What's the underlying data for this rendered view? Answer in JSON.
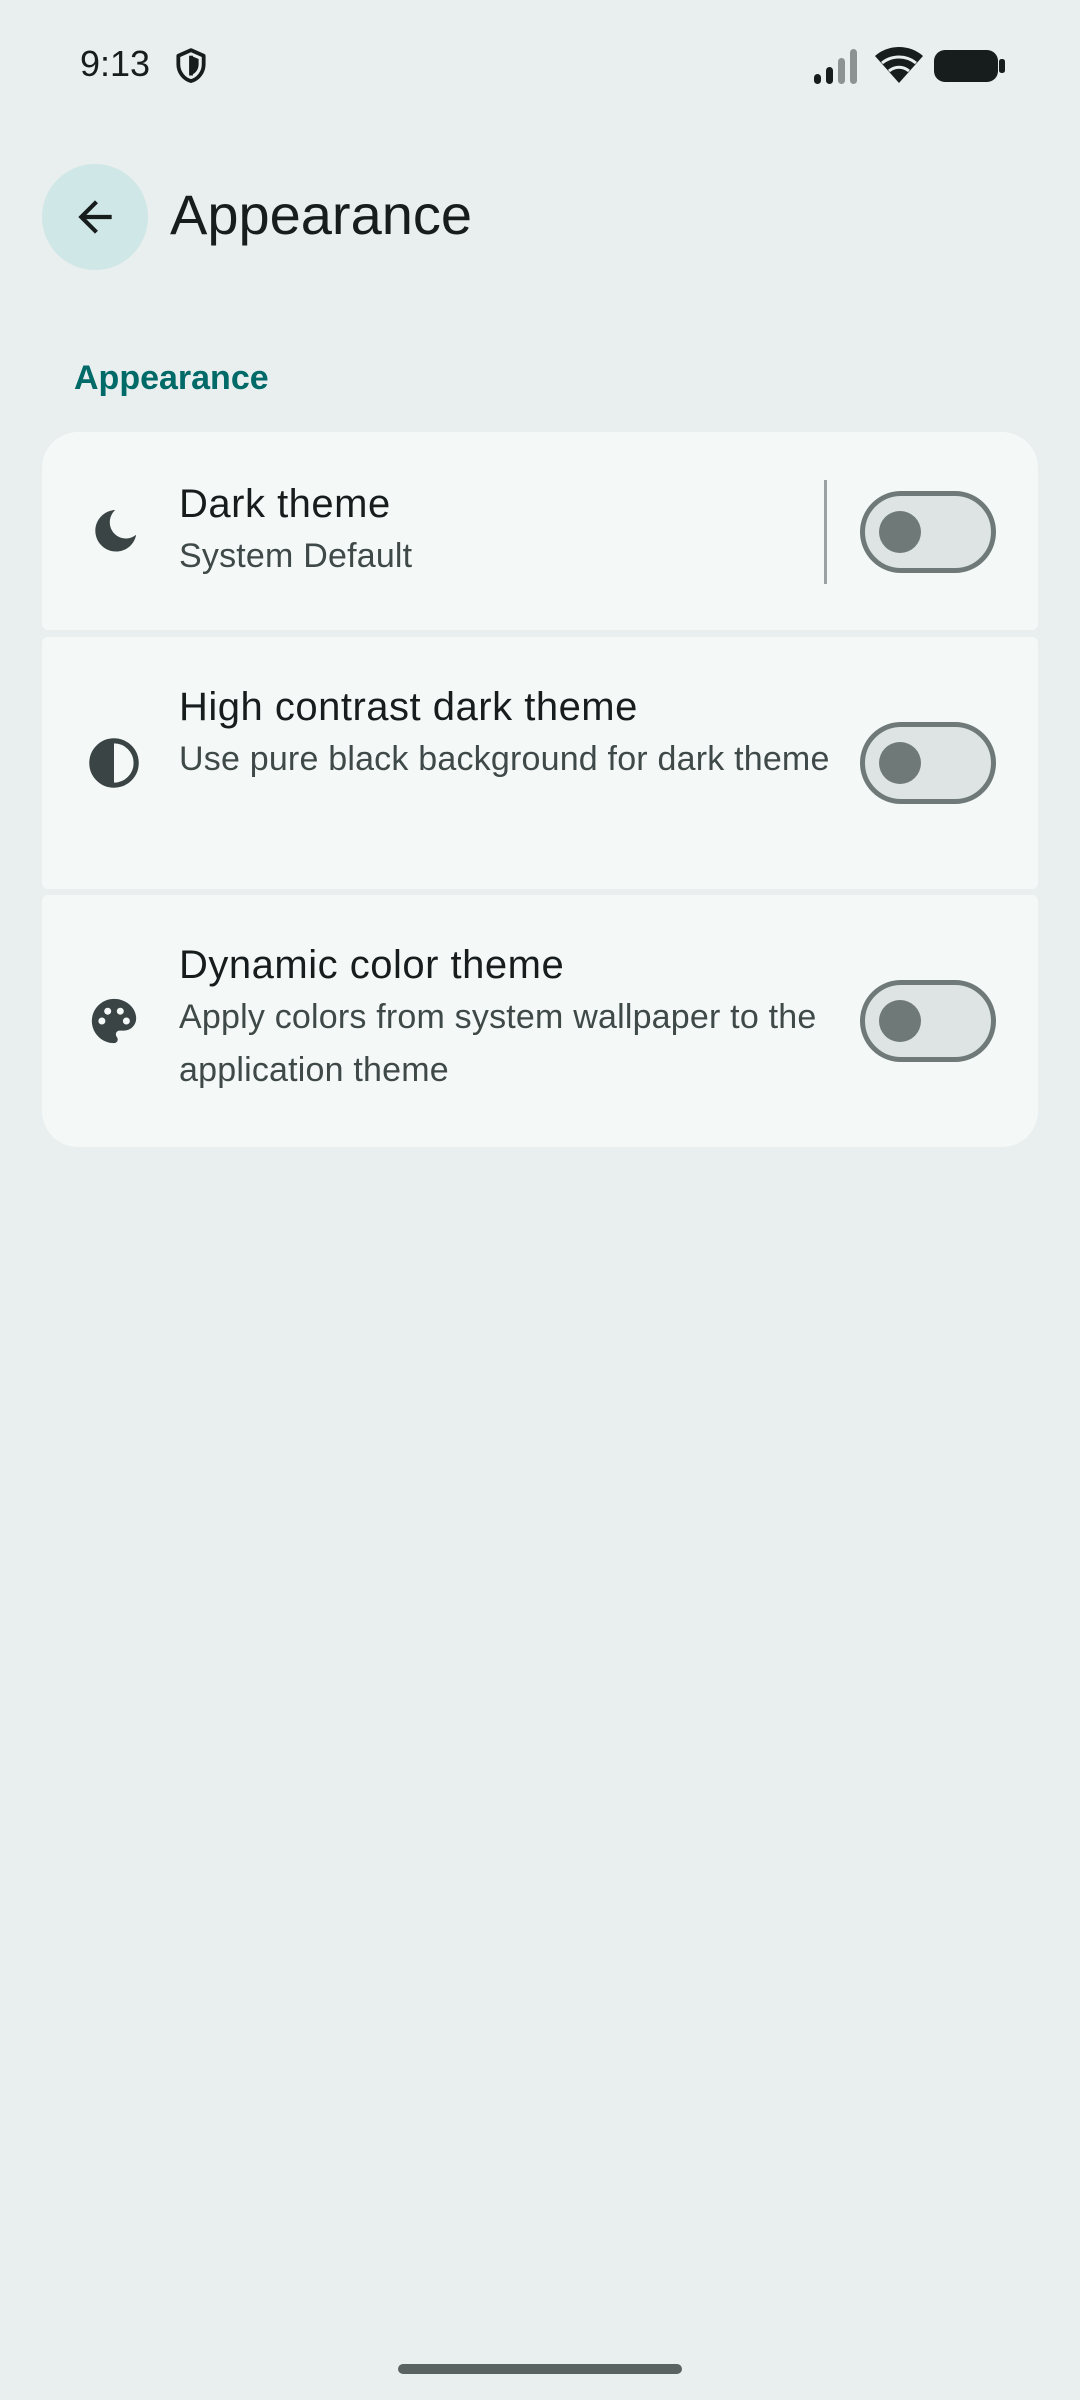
{
  "status_bar": {
    "time": "9:13",
    "icons": [
      "shield-icon",
      "signal-icon",
      "wifi-icon",
      "battery-icon"
    ]
  },
  "top_bar": {
    "back_icon": "arrow-back-icon",
    "title": "Appearance"
  },
  "section": {
    "header": "Appearance"
  },
  "settings": [
    {
      "icon": "moon-icon",
      "title": "Dark theme",
      "subtitle": "System Default",
      "switch_on": false
    },
    {
      "icon": "contrast-icon",
      "title": "High contrast dark theme",
      "subtitle": "Use pure black background for dark theme",
      "switch_on": false
    },
    {
      "icon": "palette-icon",
      "title": "Dynamic color theme",
      "subtitle": "Apply colors from system wallpaper to the application theme",
      "switch_on": false
    }
  ],
  "colors": {
    "background": "#e9eeee",
    "card": "#f4f9f8",
    "accent": "#006a68",
    "back_button_bg": "#cfe7e6",
    "switch_outline": "#6f7978"
  }
}
